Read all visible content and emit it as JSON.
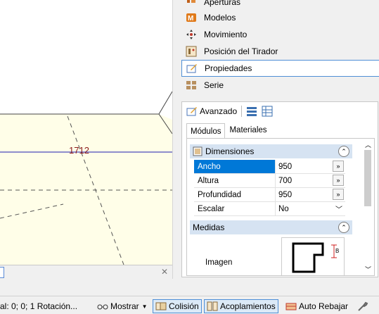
{
  "canvas": {
    "label": "1712"
  },
  "panel": {
    "menu": [
      {
        "label": "Aperturas",
        "icon": "apertures-icon"
      },
      {
        "label": "Modelos",
        "icon": "models-icon"
      },
      {
        "label": "Movimiento",
        "icon": "move-icon"
      },
      {
        "label": "Posición del Tirador",
        "icon": "handle-position-icon"
      },
      {
        "label": "Propiedades",
        "icon": "properties-icon"
      },
      {
        "label": "Serie",
        "icon": "series-icon"
      }
    ],
    "advanced_label": "Avanzado",
    "tabs": [
      {
        "label": "Módulos"
      },
      {
        "label": "Materiales"
      }
    ],
    "dimensions": {
      "title": "Dimensiones",
      "rows": [
        {
          "label": "Ancho",
          "value": "950"
        },
        {
          "label": "Altura",
          "value": "700"
        },
        {
          "label": "Profundidad",
          "value": "950"
        },
        {
          "label": "Escalar",
          "value": "No"
        }
      ]
    },
    "measures": {
      "title": "Medidas",
      "image_label": "Imagen",
      "preview_letter": "B"
    }
  },
  "statusbar": {
    "coords": "al: 0; 0; 1 Rotación...",
    "show": "Mostrar",
    "collision": "Colisión",
    "couplings": "Acoplamientos",
    "auto_rebate": "Auto Rebajar"
  },
  "colors": {
    "accent": "#0078d7",
    "panel_header": "#d6e3f2",
    "canvas_fill": "#fffee8",
    "label_red": "#8b1a1a"
  }
}
